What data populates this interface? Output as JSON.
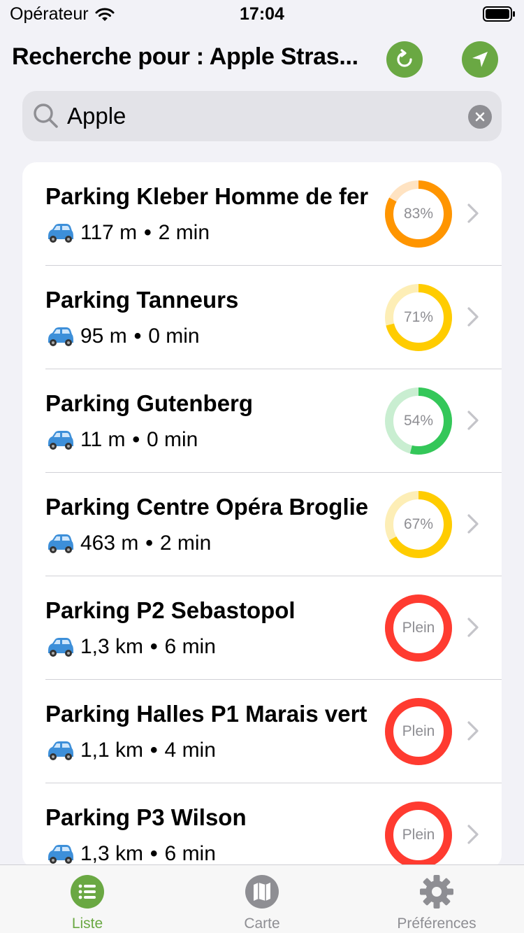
{
  "status_bar": {
    "carrier": "Opérateur",
    "time": "17:04",
    "icons": [
      "wifi-icon",
      "battery-icon"
    ]
  },
  "header": {
    "title": "Recherche pour : Apple Stras...",
    "refresh_icon": "refresh-icon",
    "locate_icon": "location-arrow-icon",
    "accent_color": "#6aa843"
  },
  "search": {
    "value": "Apple",
    "icon": "search-icon",
    "clear_icon": "clear-icon"
  },
  "parkings": [
    {
      "name": "Parking Kleber Homme de fer",
      "distance": "117 m",
      "duration": "2 min",
      "gauge_label": "83%",
      "occupancy": 0.83,
      "color": "#ff9500",
      "track": "#ffe3c2"
    },
    {
      "name": "Parking Tanneurs",
      "distance": "95 m",
      "duration": "0 min",
      "gauge_label": "71%",
      "occupancy": 0.71,
      "color": "#ffcc00",
      "track": "#fdeeb6"
    },
    {
      "name": "Parking Gutenberg",
      "distance": "11 m",
      "duration": "0 min",
      "gauge_label": "54%",
      "occupancy": 0.54,
      "color": "#34c759",
      "track": "#c9eed1"
    },
    {
      "name": "Parking Centre Opéra Broglie",
      "distance": "463 m",
      "duration": "2 min",
      "gauge_label": "67%",
      "occupancy": 0.67,
      "color": "#ffcc00",
      "track": "#fdeeb6"
    },
    {
      "name": "Parking P2 Sebastopol",
      "distance": "1,3 km",
      "duration": "6 min",
      "gauge_label": "Plein",
      "occupancy": 1.0,
      "color": "#ff3b30",
      "track": "#ffd0cd"
    },
    {
      "name": "Parking Halles P1 Marais vert",
      "distance": "1,1 km",
      "duration": "4 min",
      "gauge_label": "Plein",
      "occupancy": 1.0,
      "color": "#ff3b30",
      "track": "#ffd0cd"
    },
    {
      "name": "Parking P3 Wilson",
      "distance": "1,3 km",
      "duration": "6 min",
      "gauge_label": "Plein",
      "occupancy": 1.0,
      "color": "#ff3b30",
      "track": "#ffd0cd"
    }
  ],
  "tabs": [
    {
      "label": "Liste",
      "icon": "list-icon",
      "active": true
    },
    {
      "label": "Carte",
      "icon": "map-icon",
      "active": false
    },
    {
      "label": "Préférences",
      "icon": "gear-icon",
      "active": false
    }
  ]
}
